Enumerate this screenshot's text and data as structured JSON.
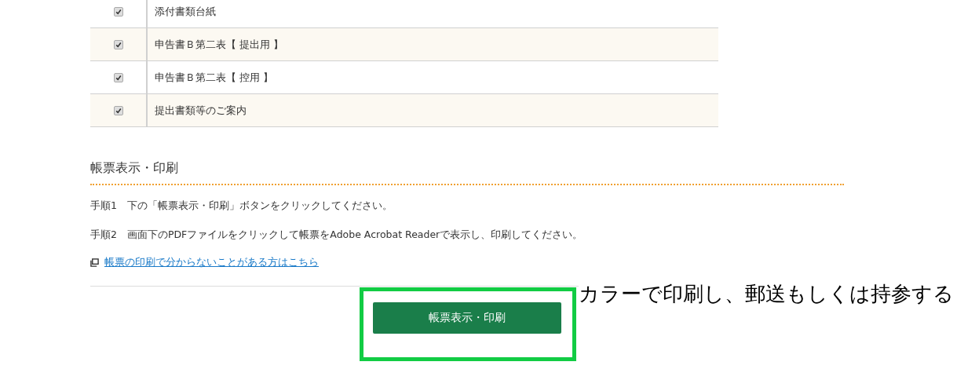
{
  "documents": [
    {
      "checked": true,
      "label": "添付書類台紙"
    },
    {
      "checked": true,
      "label": "申告書Ｂ第二表【 提出用 】"
    },
    {
      "checked": true,
      "label": "申告書Ｂ第二表【 控用 】"
    },
    {
      "checked": true,
      "label": "提出書類等のご案内"
    }
  ],
  "section": {
    "heading": "帳票表示・印刷",
    "steps": [
      "手順1　下の「帳票表示・印刷」ボタンをクリックしてください。",
      "手順2　画面下のPDFファイルをクリックして帳票をAdobe Acrobat Readerで表示し、印刷してください。"
    ],
    "help_link": "帳票の印刷で分からないことがある方はこちら",
    "button": "帳票表示・印刷"
  },
  "annotation": "カラーで印刷し、郵送もしくは持参する"
}
